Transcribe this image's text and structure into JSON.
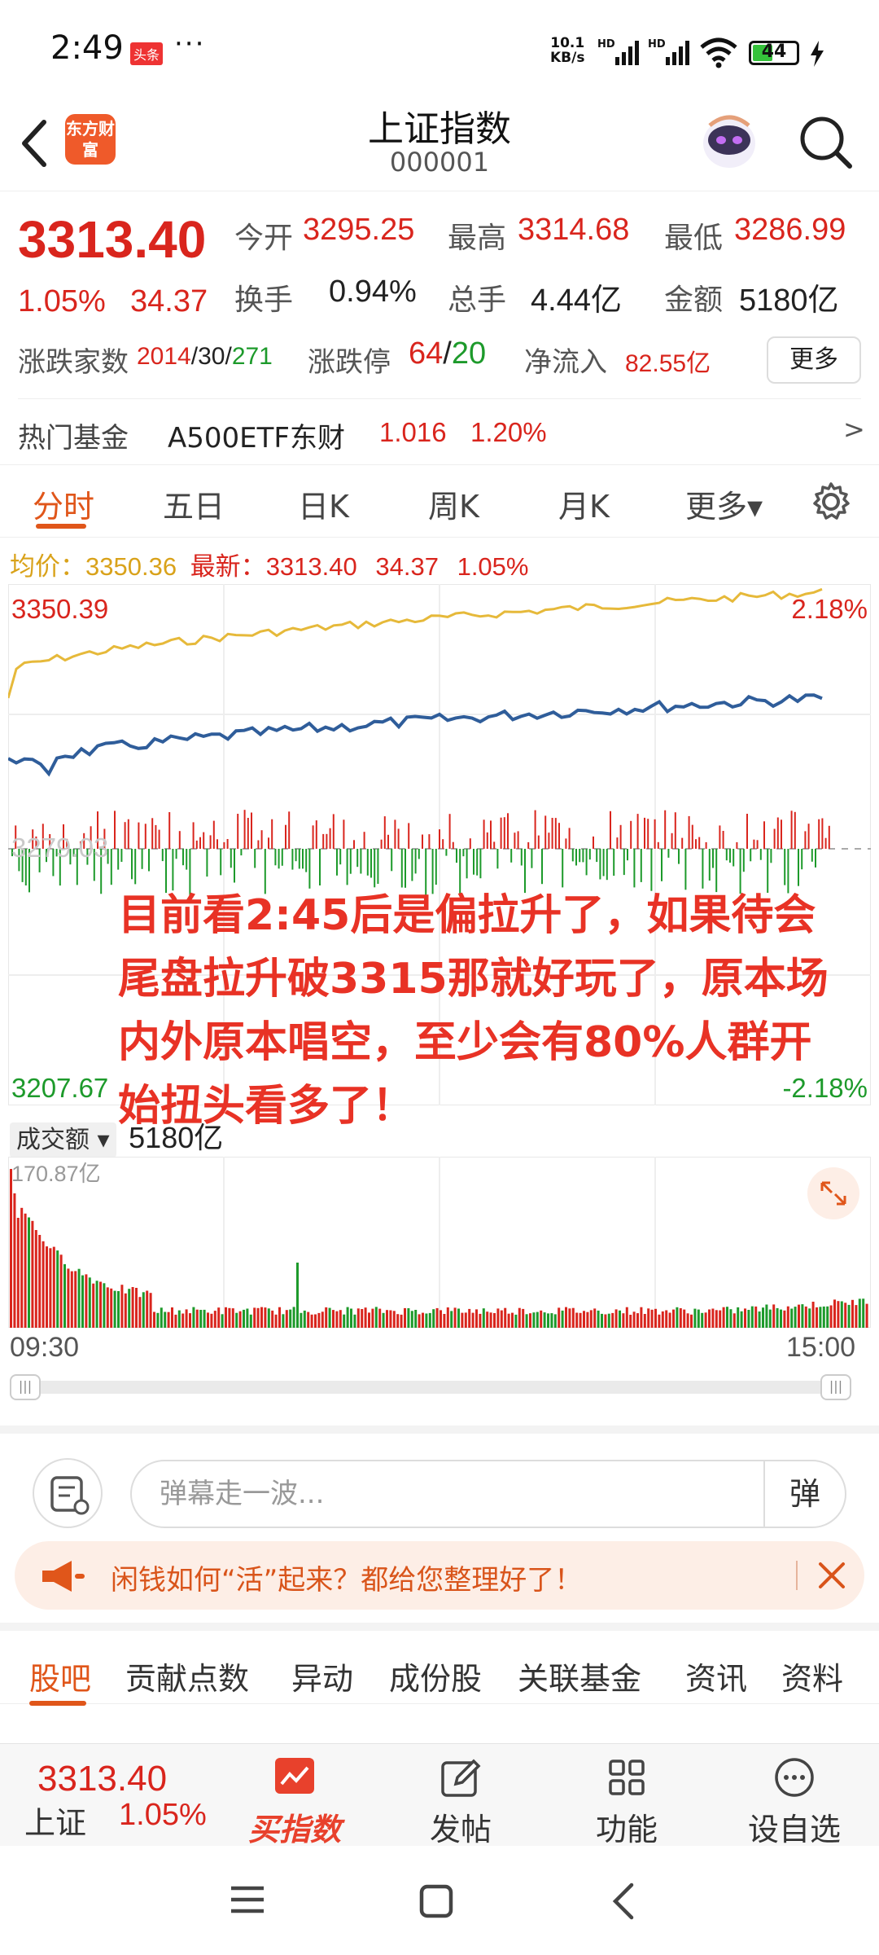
{
  "status_bar": {
    "time": "2:49",
    "toutiao_badge": "头条",
    "more_dots": "···",
    "net_speed_value": "10.1",
    "net_speed_unit": "KB/s",
    "battery": "44"
  },
  "header": {
    "logo_text": "东方财富",
    "title": "上证指数",
    "code": "000001"
  },
  "quote": {
    "price": "3313.40",
    "change_pct": "1.05%",
    "change": "34.37",
    "open_label": "今开",
    "open": "3295.25",
    "high_label": "最高",
    "high": "3314.68",
    "low_label": "最低",
    "low": "3286.99",
    "turnover_label": "换手",
    "turnover": "0.94%",
    "volume_label": "总手",
    "volume": "4.44亿",
    "amount_label": "金额",
    "amount": "5180亿",
    "updown_label": "涨跌家数",
    "up_count": "2014",
    "flat_count": "30",
    "down_count": "271",
    "sep": "/",
    "limit_label": "涨跌停",
    "limit_up": "64",
    "limit_down": "20",
    "inflow_label": "净流入",
    "inflow": "82.55亿",
    "more_button": "更多"
  },
  "hot_fund": {
    "label": "热门基金",
    "name": "A500ETF东财",
    "price": "1.016",
    "pct": "1.20%",
    "arrow": ">"
  },
  "tabs": [
    "分时",
    "五日",
    "日K",
    "周K",
    "月K",
    "更多▾"
  ],
  "chart_info": {
    "avg_label": "均价：",
    "avg": "3350.36",
    "latest_label": "最新：",
    "latest": "3313.40",
    "change": "34.37",
    "pct": "1.05%"
  },
  "chart_data": {
    "type": "line",
    "y_max_label": "3350.39",
    "y_min_label": "3207.67",
    "y_mid_label": "3279.03",
    "pct_max_label": "2.18%",
    "pct_min_label": "-2.18%",
    "ylim": [
      3207.67,
      3350.39
    ],
    "x_start": "09:30",
    "x_end": "15:00",
    "series": []
  },
  "annotation": "目前看2:45后是偏拉升了，如果待会尾盘拉升破3315那就好玩了，原本场内外原本唱空，至少会有80%人群开始扭头看多了！",
  "volume": {
    "label": "成交额",
    "total": "5180亿",
    "max_label": "170.87亿",
    "start_time": "09:30",
    "end_time": "15:00"
  },
  "danmaku": {
    "placeholder": "弹幕走一波...",
    "button": "弹"
  },
  "banner": {
    "text": "闲钱如何“活”起来？都给您整理好了！"
  },
  "subtabs": [
    "股吧",
    "贡献点数",
    "异动",
    "成份股",
    "关联基金",
    "资讯",
    "资料"
  ],
  "toolbar": {
    "price": "3313.40",
    "name": "上证",
    "pct": "1.05%",
    "buy_index": "买指数",
    "post": "发帖",
    "function": "功能",
    "watchlist": "设自选"
  },
  "colors": {
    "up": "#d9251d",
    "down": "#1d9a2b",
    "accent": "#e0561a",
    "avg_line": "#e6b93a",
    "price_line": "#2f5d9a"
  }
}
